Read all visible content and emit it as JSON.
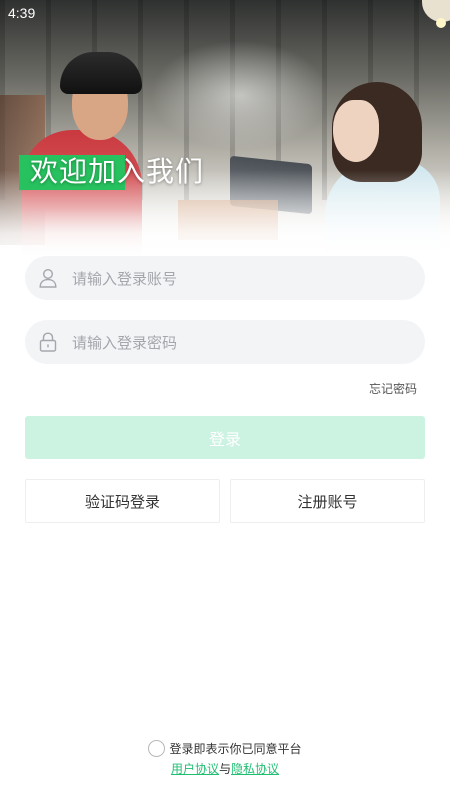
{
  "status_bar": {
    "time": "4:39"
  },
  "hero": {
    "title": "欢迎加入我们"
  },
  "form": {
    "account_placeholder": "请输入登录账号",
    "password_placeholder": "请输入登录密码",
    "forgot_password": "忘记密码",
    "login_button": "登录",
    "sms_login_button": "验证码登录",
    "register_button": "注册账号"
  },
  "agreement": {
    "prefix": "登录即表示你已同意平台",
    "user_agreement": "用户协议",
    "connector": "与",
    "privacy_policy": "隐私协议",
    "agreed": false
  },
  "colors": {
    "accent_green": "#27c25f",
    "login_button_bg": "#ccf3e2",
    "link_green": "#1fbf72",
    "field_bg": "#f3f4f6"
  },
  "icons": {
    "account": "user-icon",
    "password": "lock-icon"
  }
}
